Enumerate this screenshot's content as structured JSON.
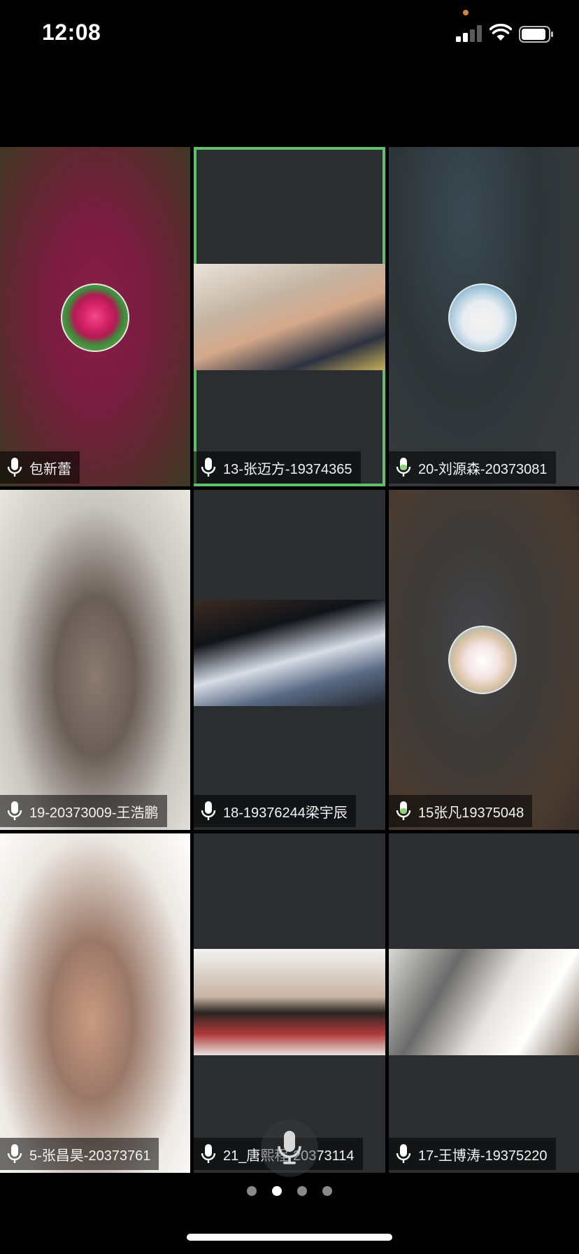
{
  "status_bar": {
    "time": "12:08",
    "signal_bars_active": 2,
    "signal_bars_total": 4,
    "battery_level": 0.92
  },
  "participants": [
    {
      "name": "包新蕾",
      "media": "avatar",
      "avatar_icon": "flower-avatar",
      "mic_color": "#ffffff"
    },
    {
      "name": "13-张迈方-19374365",
      "media": "video",
      "speaking": true,
      "mic_color": "#ffffff"
    },
    {
      "name": "20-刘源森-20373081",
      "media": "avatar",
      "avatar_icon": "anime-girl-avatar",
      "mic_color": "#8fd27f"
    },
    {
      "name": "19-20373009-王浩鹏",
      "media": "video",
      "mic_color": "#ffffff"
    },
    {
      "name": "18-19376244梁宇辰",
      "media": "video",
      "mic_color": "#ffffff"
    },
    {
      "name": "15张凡19375048",
      "media": "avatar",
      "avatar_icon": "anime-cat-avatar",
      "mic_color": "#8fd27f"
    },
    {
      "name": "5-张昌昊-20373761",
      "media": "video",
      "mic_color": "#ffffff"
    },
    {
      "name": "21_唐熙程-20373114",
      "media": "video",
      "mic_color": "#ffffff"
    },
    {
      "name": "17-王博涛-19375220",
      "media": "video",
      "mic_color": "#ffffff"
    }
  ],
  "controls": {
    "mute_button_icon": "microphone-icon"
  },
  "pager": {
    "total_pages": 4,
    "current_page": 2
  },
  "colors": {
    "speaking_border": "#5fbf6a",
    "tile_background": "#2b2e30",
    "name_tag_bg": "rgba(0,0,0,0.55)"
  }
}
